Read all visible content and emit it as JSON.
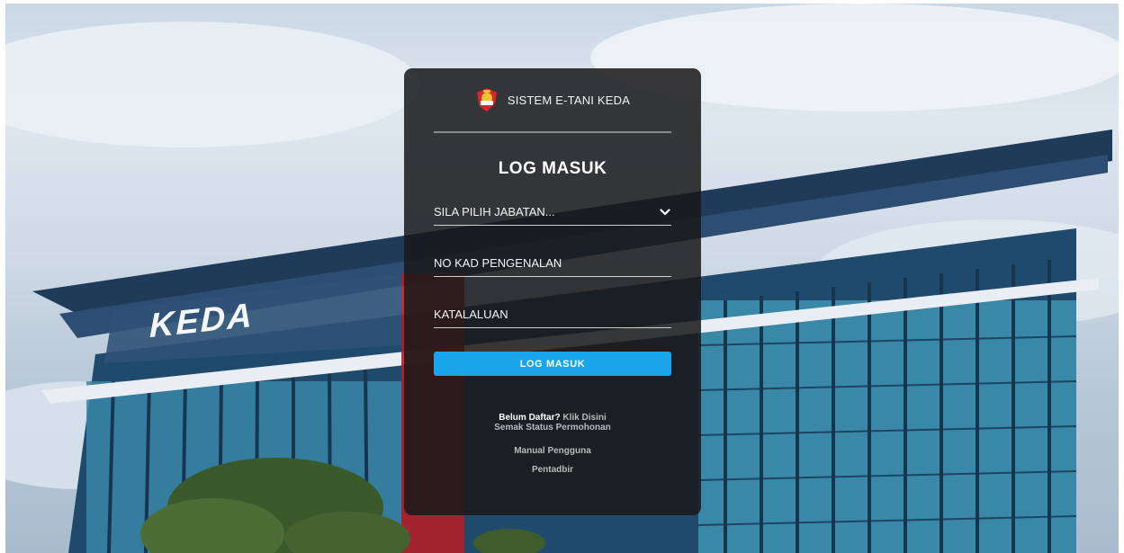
{
  "header": {
    "app_name": "SISTEM E-TANI KEDA"
  },
  "background": {
    "building_sign": "KEDA"
  },
  "form": {
    "title": "LOG MASUK",
    "department_select": "SILA PILIH JABATAN...",
    "ic_field": "NO KAD PENGENALAN",
    "password_field": "KATALALUAN",
    "submit_label": "LOG MASUK"
  },
  "links": {
    "register_question": "Belum Daftar?",
    "register_link": "Klik Disini",
    "status_link": "Semak Status Permohonan",
    "manual_link": "Manual Pengguna",
    "admin_link": "Pentadbir"
  },
  "colors": {
    "primary_button": "#1aa5ea",
    "card_background": "#18181a",
    "logo_red": "#d8262c",
    "logo_gold": "#f2c230"
  },
  "icons": {
    "logo": "keda-crest-logo",
    "select_arrow": "chevron-down-icon"
  }
}
